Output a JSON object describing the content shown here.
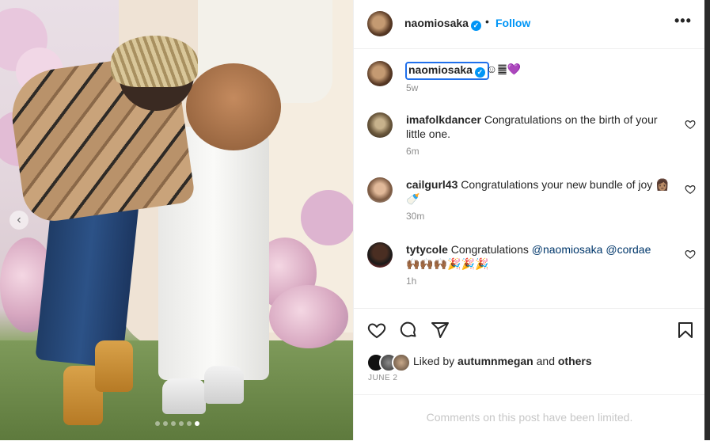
{
  "header": {
    "username": "naomiosaka",
    "separator": "•",
    "follow_label": "Follow",
    "more_label": "•••"
  },
  "caption": {
    "username": "naomiosaka",
    "emojis": "☺︎䷀",
    "heart": "💜",
    "time": "5w"
  },
  "comments": [
    {
      "username": "imafolkdancer",
      "text": " Congratulations on the birth of your little one.",
      "time": "6m"
    },
    {
      "username": "cailgurl43",
      "text": " Congratulations your new bundle of joy 👩🏽🍼",
      "time": "30m"
    },
    {
      "username": "tytycole",
      "text_before": " Congratulations ",
      "mention1": "@naomiosaka",
      "mention2": "@cordae",
      "text_after": "🙌🏾🙌🏾🙌🏾🎉🎉🎉",
      "time": "1h"
    }
  ],
  "likes": {
    "prefix": "Liked by ",
    "user": "autumnmegan",
    "middle": " and ",
    "others": "others"
  },
  "date": "JUNE 2",
  "limited_notice": "Comments on this post have been limited.",
  "carousel": {
    "prev_icon": "‹",
    "total": 6,
    "active_index": 5
  },
  "colors": {
    "accent": "#0095f6",
    "muted": "#8e8e8e",
    "text": "#262626",
    "mention": "#00376b"
  },
  "icons": [
    "verified-badge-icon",
    "more-options-icon",
    "heart-icon",
    "comment-icon",
    "share-icon",
    "bookmark-icon",
    "chevron-left-icon"
  ]
}
